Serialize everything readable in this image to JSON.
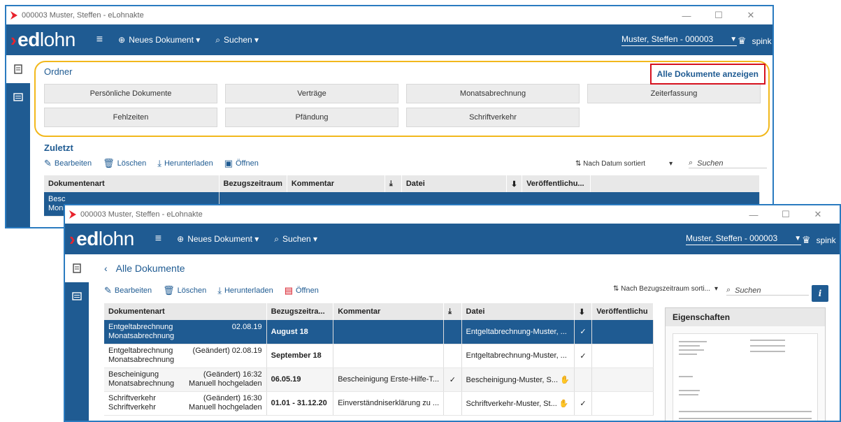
{
  "window1": {
    "title": "000003 Muster, Steffen - eLohnakte",
    "brand_bold": "ed",
    "brand_light": "lohn",
    "nav": {
      "new_doc": "Neues Dokument",
      "search": "Suchen"
    },
    "user": "Muster, Steffen - 000003",
    "account": "spink",
    "ordner_title": "Ordner",
    "alle_link": "Alle Dokumente anzeigen",
    "folders": [
      "Persönliche Dokumente",
      "Verträge",
      "Monatsabrechnung",
      "Zeiterfassung",
      "Fehlzeiten",
      "Pfändung",
      "Schriftverkehr"
    ],
    "recent_title": "Zuletzt",
    "toolbar": {
      "edit": "Bearbeiten",
      "delete": "Löschen",
      "download": "Herunterladen",
      "open": "Öffnen"
    },
    "sort": "Nach Datum sortiert",
    "search_placeholder": "Suchen",
    "columns": [
      "Dokumentenart",
      "Bezugszeitraum",
      "Kommentar",
      "Datei",
      "Veröffentlichu..."
    ],
    "partial_row": [
      "Besc",
      "Monat"
    ]
  },
  "window2": {
    "title": "000003 Muster, Steffen - eLohnakte",
    "brand_bold": "ed",
    "brand_light": "lohn",
    "nav": {
      "new_doc": "Neues Dokument",
      "search": "Suchen"
    },
    "user": "Muster, Steffen - 000003",
    "account": "spink",
    "back_label": "Alle Dokumente",
    "toolbar": {
      "edit": "Bearbeiten",
      "delete": "Löschen",
      "download": "Herunterladen",
      "open": "Öffnen"
    },
    "sort": "Nach Bezugszeitraum sorti...",
    "search_placeholder": "Suchen",
    "columns": [
      "Dokumentenart",
      "Bezugszeitra...",
      "Kommentar",
      "Datei",
      "Veröffentlichu"
    ],
    "rows": [
      {
        "type1": "Entgeltabrechnung",
        "type2": "Monatsabrechnung",
        "date": "02.08.19",
        "note": "",
        "period": "August 18",
        "comment": "",
        "checked": "",
        "file": "Entgeltabrechnung-Muster, ...",
        "hand": "",
        "published": "✓"
      },
      {
        "type1": "Entgeltabrechnung",
        "type2": "Monatsabrechnung",
        "date": "(Geändert) 02.08.19",
        "note": "",
        "period": "September 18",
        "comment": "",
        "checked": "",
        "file": "Entgeltabrechnung-Muster, ...",
        "hand": "",
        "published": "✓"
      },
      {
        "type1": "Bescheinigung",
        "type2": "Monatsabrechnung",
        "date": "(Geändert) 16:32",
        "note": "Manuell hochgeladen",
        "period": "06.05.19",
        "comment": "Bescheinigung Erste-Hilfe-T...",
        "checked": "✓",
        "file": "Bescheinigung-Muster, S...",
        "hand": "✋",
        "published": ""
      },
      {
        "type1": "Schriftverkehr",
        "type2": "Schriftverkehr",
        "date": "(Geändert) 16:30",
        "note": "Manuell hochgeladen",
        "period": "01.01 - 31.12.20",
        "comment": "Einverständniserklärung zu ...",
        "checked": "",
        "file": "Schriftverkehr-Muster, St...",
        "hand": "✋",
        "published": "✓"
      }
    ],
    "props_title": "Eigenschaften"
  },
  "colors": {
    "primary": "#1f5b92",
    "accent_red": "#e8232d",
    "highlight_yellow": "#f2b81c",
    "highlight_red": "#d6111e"
  }
}
